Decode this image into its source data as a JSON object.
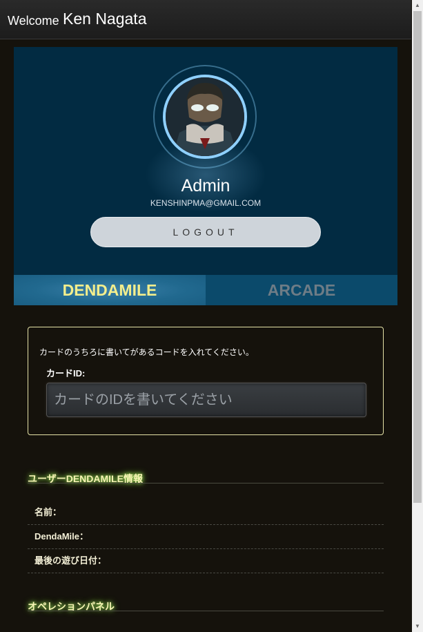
{
  "header": {
    "welcome": "Welcome",
    "user_name": "Ken Nagata"
  },
  "profile": {
    "name": "Admin",
    "email": "KENSHINPMA@GMAIL.COM",
    "logout_label": "LOGOUT"
  },
  "tabs": [
    {
      "label": "DENDAMILE",
      "active": true
    },
    {
      "label": "ARCADE",
      "active": false
    }
  ],
  "card": {
    "instruction": "カードのうちろに書いてがあるコードを入れてください。",
    "label": "カードID:",
    "placeholder": "カードのIDを書いてください"
  },
  "user_info": {
    "title": "ユーザーDENDAMILE情報",
    "rows": [
      {
        "label": "名前："
      },
      {
        "label": "DendaMile："
      },
      {
        "label": "最後の遊び日付："
      }
    ]
  },
  "operation_panel": {
    "title": "オペレションパネル"
  },
  "colors": {
    "background": "#15120c",
    "profile_bg": "#022b42",
    "accent_yellow": "#f3ee8c",
    "tab_active": "#21698f",
    "tab_inactive": "#0b4a6b"
  }
}
